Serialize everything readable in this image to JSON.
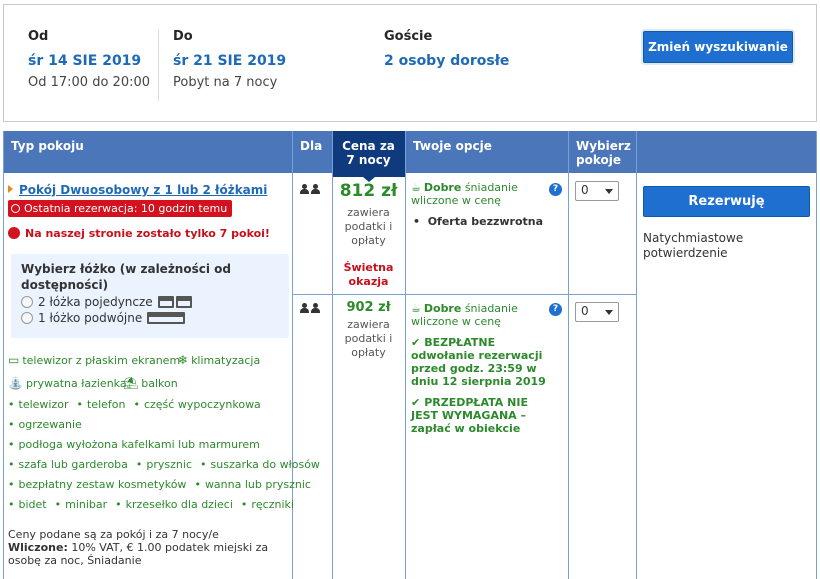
{
  "search": {
    "checkin_label": "Od",
    "checkin_date": "śr 14 SIE 2019",
    "checkin_time": "Od 17:00 do 20:00",
    "checkout_label": "Do",
    "checkout_date": "śr 21 SIE 2019",
    "checkout_note": "Pobyt na 7 nocy",
    "guests_label": "Goście",
    "guests_value": "2 osoby dorosłe",
    "change_button": "Zmień wyszukiwanie"
  },
  "table_headers": {
    "room_type": "Typ pokoju",
    "for": "Dla",
    "price": "Cena za 7 nocy",
    "options": "Twoje opcje",
    "select_rooms": "Wybierz pokoje"
  },
  "room": {
    "name": "Pokój Dwuosobowy z 1 lub 2 łóżkami",
    "last_booking": "Ostatnia rezerwacja: 10 godzin temu",
    "rooms_left": "Na naszej stronie zostało tylko 7 pokoi!",
    "bed_title": "Wybierz łóżko (w zależności od dostępności)",
    "bed_options": [
      "2 łóżka pojedyncze",
      "1 łóżko podwójne"
    ],
    "amenities": [
      "telewizor z płaskim ekranem",
      "klimatyzacja",
      "prywatna łazienka",
      "balkon"
    ],
    "facilities_rows": [
      [
        "telewizor",
        "telefon",
        "część wypoczynkowa"
      ],
      [
        "ogrzewanie"
      ],
      [
        "podłoga wyłożona kafelkami lub marmurem"
      ],
      [
        "szafa lub garderoba",
        "prysznic",
        "suszarka do włosów"
      ],
      [
        "bezpłatny zestaw kosmetyków",
        "wanna lub prysznic"
      ],
      [
        "bidet",
        "minibar",
        "krzesełko dla dzieci",
        "ręczniki"
      ]
    ],
    "footnote_line1": "Ceny podane są za pokój i za 7 nocy/e",
    "footnote_bold": "Wliczone:",
    "footnote_rest": " 10% VAT, € 1.00 podatek miejski za osobę za noc, Śniadanie"
  },
  "offers": [
    {
      "price": "812 zł",
      "price_color": "#2c8a2c",
      "price_note": "zawiera podatki i opłaty",
      "deal": "Świetna okazja",
      "breakfast_bold": "Dobre",
      "breakfast_rest": " śniadanie wliczone w cenę",
      "policy": "Oferta bezzwrotna",
      "quantity": "0"
    },
    {
      "price": "902 zł",
      "price_color": "#2c8a2c",
      "price_note": "zawiera podatki i opłaty",
      "breakfast_bold": "Dobre",
      "breakfast_rest": " śniadanie wliczone w cenę",
      "cancel": "BEZPŁATNE odwołanie rezerwacji przed godz. 23:59 w dniu 12 sierpnia 2019",
      "prepay": "PRZEDPŁATA NIE JEST WYMAGANA – zapłać w obiekcie",
      "quantity": "0"
    }
  ],
  "reserve": {
    "button": "Rezerwuję",
    "instant": "Natychmiastowe potwierdzenie"
  },
  "colors": {
    "header_bg": "#4b76b9",
    "price_header_bg": "#0f3a7e",
    "link": "#1e6ab7",
    "green": "#2c8a2c",
    "red": "#c8101b",
    "button": "#1e6fd0"
  }
}
